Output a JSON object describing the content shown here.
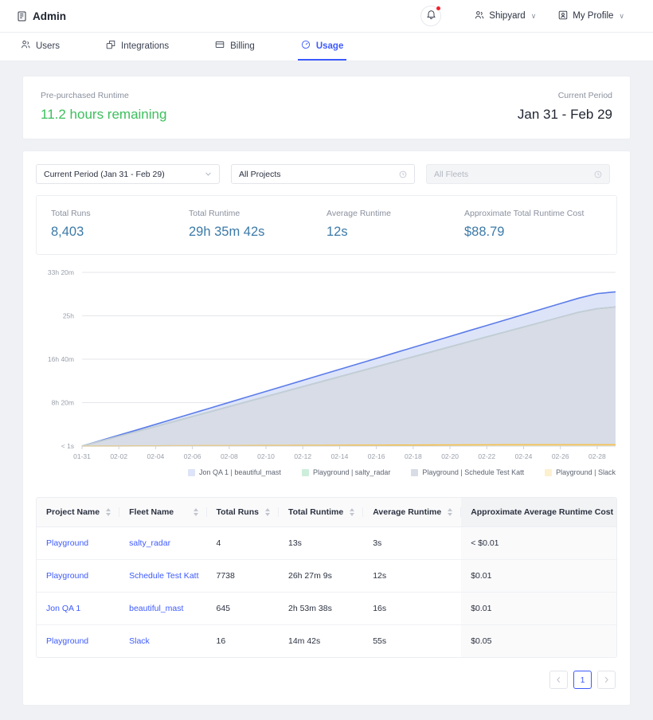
{
  "header": {
    "brand": "Admin",
    "brand_icon": "book-icon",
    "bell_icon": "bell-icon",
    "org_menu": {
      "label": "Shipyard",
      "icon": "people-icon",
      "caret": "∨"
    },
    "profile_menu": {
      "label": "My Profile",
      "icon": "profile-box-icon",
      "caret": "∨"
    }
  },
  "tabs": [
    {
      "label": "Users",
      "icon": "users-icon",
      "active": false
    },
    {
      "label": "Integrations",
      "icon": "integrations-icon",
      "active": false
    },
    {
      "label": "Billing",
      "icon": "billing-icon",
      "active": false
    },
    {
      "label": "Usage",
      "icon": "usage-gauge-icon",
      "active": true
    }
  ],
  "summary": {
    "prepurchased_label": "Pre-purchased Runtime",
    "prepurchased_value": "11.2 hours remaining",
    "period_label": "Current Period",
    "period_value": "Jan 31 - Feb 29",
    "green": "#3cbf5c"
  },
  "filters": {
    "period": {
      "value": "Current Period (Jan 31 - Feb 29)",
      "icon": "chevron-down-icon"
    },
    "projects": {
      "value": "All Projects",
      "icon": "clock-icon"
    },
    "fleets": {
      "placeholder": "All Fleets",
      "value": "",
      "icon": "clock-icon",
      "disabled": true
    }
  },
  "stats": [
    {
      "label": "Total Runs",
      "value": "8,403"
    },
    {
      "label": "Total Runtime",
      "value": "29h 35m 42s"
    },
    {
      "label": "Average Runtime",
      "value": "12s"
    },
    {
      "label": "Approximate Total Runtime Cost",
      "value": "$88.79"
    }
  ],
  "chart_data": {
    "type": "area",
    "title": "",
    "xlabel": "",
    "ylabel": "",
    "stacked": true,
    "grid": true,
    "legend_position": "bottom-right",
    "y_ticks": [
      "< 1s",
      "8h 20m",
      "16h 40m",
      "25h",
      "33h 20m"
    ],
    "y_tick_values": [
      0,
      30000,
      60000,
      90000,
      120000
    ],
    "ylim": [
      0,
      120000
    ],
    "y_unit": "seconds",
    "x": [
      "01-31",
      "02-01",
      "02-02",
      "02-03",
      "02-04",
      "02-05",
      "02-06",
      "02-07",
      "02-08",
      "02-09",
      "02-10",
      "02-11",
      "02-12",
      "02-13",
      "02-14",
      "02-15",
      "02-16",
      "02-17",
      "02-18",
      "02-19",
      "02-20",
      "02-21",
      "02-22",
      "02-23",
      "02-24",
      "02-25",
      "02-26",
      "02-27",
      "02-28",
      "02-29"
    ],
    "x_tick_labels": [
      "01-31",
      "02-02",
      "02-04",
      "02-06",
      "02-08",
      "02-10",
      "02-12",
      "02-14",
      "02-16",
      "02-18",
      "02-20",
      "02-22",
      "02-24",
      "02-26",
      "02-28"
    ],
    "series": [
      {
        "name": "Playground | Slack",
        "color": "#f5c24c",
        "fill": "#fdf0cf",
        "values": [
          0,
          30,
          60,
          90,
          120,
          160,
          200,
          240,
          280,
          320,
          360,
          400,
          440,
          480,
          520,
          560,
          600,
          640,
          680,
          720,
          760,
          800,
          820,
          840,
          860,
          870,
          880,
          882,
          882,
          882
        ]
      },
      {
        "name": "Playground | Schedule Test Katt",
        "color": "#c7ccd8",
        "fill": "#d8dce6",
        "values": [
          0,
          3300,
          6700,
          10000,
          13400,
          16800,
          20200,
          23600,
          27000,
          30400,
          33800,
          37200,
          40600,
          44000,
          47400,
          50800,
          54200,
          57600,
          61000,
          64400,
          67800,
          71200,
          74600,
          78000,
          81400,
          84800,
          88200,
          91600,
          94029,
          95229
        ]
      },
      {
        "name": "Playground | salty_radar",
        "color": "#6fcf97",
        "fill": "#cdeedb",
        "values": [
          0,
          1,
          2,
          3,
          4,
          5,
          6,
          7,
          8,
          9,
          10,
          11,
          12,
          13,
          13,
          13,
          13,
          13,
          13,
          13,
          13,
          13,
          13,
          13,
          13,
          13,
          13,
          13,
          13,
          13
        ]
      },
      {
        "name": "Jon QA 1 | beautiful_mast",
        "color": "#5b7ce8",
        "fill": "#dde4f8",
        "values": [
          0,
          360,
          720,
          1080,
          1440,
          1800,
          2160,
          2520,
          2880,
          3240,
          3600,
          3960,
          4320,
          4680,
          5040,
          5400,
          5760,
          6120,
          6480,
          6840,
          7200,
          7560,
          7920,
          8280,
          8640,
          9000,
          9360,
          9720,
          10418,
          10418
        ]
      }
    ],
    "stacked_total_final": "29h 35m 42s"
  },
  "table": {
    "columns": [
      {
        "label": "Project Name",
        "sorted": false
      },
      {
        "label": "Fleet Name",
        "sorted": false
      },
      {
        "label": "Total Runs",
        "sorted": false
      },
      {
        "label": "Total Runtime",
        "sorted": false
      },
      {
        "label": "Average Runtime",
        "sorted": false
      },
      {
        "label": "Approximate Average Runtime Cost",
        "sorted": true
      }
    ],
    "rows": [
      {
        "project": "Playground",
        "fleet": "salty_radar",
        "runs": "4",
        "total_runtime": "13s",
        "avg_runtime": "3s",
        "cost": "< $0.01"
      },
      {
        "project": "Playground",
        "fleet": "Schedule Test Katt",
        "runs": "7738",
        "total_runtime": "26h 27m 9s",
        "avg_runtime": "12s",
        "cost": "$0.01"
      },
      {
        "project": "Jon QA 1",
        "fleet": "beautiful_mast",
        "runs": "645",
        "total_runtime": "2h 53m 38s",
        "avg_runtime": "16s",
        "cost": "$0.01"
      },
      {
        "project": "Playground",
        "fleet": "Slack",
        "runs": "16",
        "total_runtime": "14m 42s",
        "avg_runtime": "55s",
        "cost": "$0.05"
      }
    ]
  },
  "pagination": {
    "prev_icon": "chevron-left-icon",
    "next_icon": "chevron-right-icon",
    "current_page": "1"
  }
}
